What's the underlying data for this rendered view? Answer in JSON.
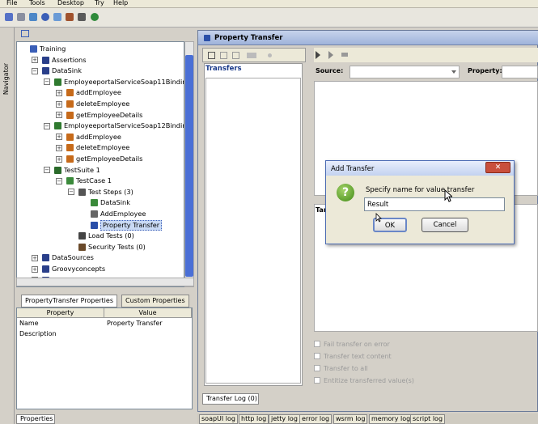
{
  "menu": [
    "File",
    "Tools",
    "Desktop",
    "Try",
    "Help"
  ],
  "navigator": {
    "tab_label": "Navigator"
  },
  "tree": [
    {
      "label": "Training",
      "indent": 0,
      "expander": "",
      "icon": "project-icon"
    },
    {
      "label": "Assertions",
      "indent": 1,
      "expander": "+",
      "icon": "folder-icon"
    },
    {
      "label": "DataSink",
      "indent": 1,
      "expander": "-",
      "icon": "folder-icon"
    },
    {
      "label": "EmployeeportalServiceSoap11Binding",
      "indent": 2,
      "expander": "-",
      "icon": "interface-icon"
    },
    {
      "label": "addEmployee",
      "indent": 3,
      "expander": "+",
      "icon": "operation-icon"
    },
    {
      "label": "deleteEmployee",
      "indent": 3,
      "expander": "+",
      "icon": "operation-icon"
    },
    {
      "label": "getEmployeeDetails",
      "indent": 3,
      "expander": "+",
      "icon": "operation-icon"
    },
    {
      "label": "EmployeeportalServiceSoap12Binding",
      "indent": 2,
      "expander": "-",
      "icon": "interface-icon"
    },
    {
      "label": "addEmployee",
      "indent": 3,
      "expander": "+",
      "icon": "operation-icon"
    },
    {
      "label": "deleteEmployee",
      "indent": 3,
      "expander": "+",
      "icon": "operation-icon"
    },
    {
      "label": "getEmployeeDetails",
      "indent": 3,
      "expander": "+",
      "icon": "operation-icon"
    },
    {
      "label": "TestSuite 1",
      "indent": 2,
      "expander": "-",
      "icon": "testsuite-icon"
    },
    {
      "label": "TestCase 1",
      "indent": 3,
      "expander": "-",
      "icon": "testcase-icon"
    },
    {
      "label": "Test Steps (3)",
      "indent": 4,
      "expander": "-",
      "icon": "teststeps-icon"
    },
    {
      "label": "DataSink",
      "indent": 5,
      "expander": "",
      "icon": "datasink-icon"
    },
    {
      "label": "AddEmployee",
      "indent": 5,
      "expander": "",
      "icon": "request-icon"
    },
    {
      "label": "Property Transfer",
      "indent": 5,
      "expander": "",
      "icon": "property-transfer-icon",
      "selected": true
    },
    {
      "label": "Load Tests (0)",
      "indent": 4,
      "expander": "",
      "icon": "loadtest-icon"
    },
    {
      "label": "Security Tests (0)",
      "indent": 4,
      "expander": "",
      "icon": "securitytest-icon"
    },
    {
      "label": "DataSources",
      "indent": 1,
      "expander": "+",
      "icon": "folder-icon"
    },
    {
      "label": "Groovyconcepts",
      "indent": 1,
      "expander": "+",
      "icon": "folder-icon"
    },
    {
      "label": "Properties",
      "indent": 1,
      "expander": "+",
      "icon": "folder-icon"
    }
  ],
  "property_tabs": [
    "PropertyTransfer Properties",
    "Custom Properties"
  ],
  "property_table": {
    "columns": [
      "Property",
      "Value"
    ],
    "rows": [
      [
        "Name",
        "Property Transfer"
      ],
      [
        "Description",
        ""
      ]
    ]
  },
  "bottom_tab": "Properties",
  "panel": {
    "title": "Property Transfer",
    "transfers_label": "Transfers",
    "source_label": "Source:",
    "property_label": "Property:",
    "target_label_partial": "Tar",
    "options": [
      "Fail transfer on error",
      "Transfer text content",
      "Transfer to all",
      "Entitize transferred value(s)"
    ],
    "transfer_log_tab": "Transfer Log (0)"
  },
  "log_tabs": [
    "soapUI log",
    "http log",
    "jetty log",
    "error log",
    "wsrm log",
    "memory log",
    "script log"
  ],
  "dialog": {
    "title": "Add Transfer",
    "prompt": "Specify name for value transfer",
    "input_value": "Result",
    "ok_label": "OK",
    "cancel_label": "Cancel",
    "close_glyph": "✕",
    "icon_glyph": "?"
  }
}
